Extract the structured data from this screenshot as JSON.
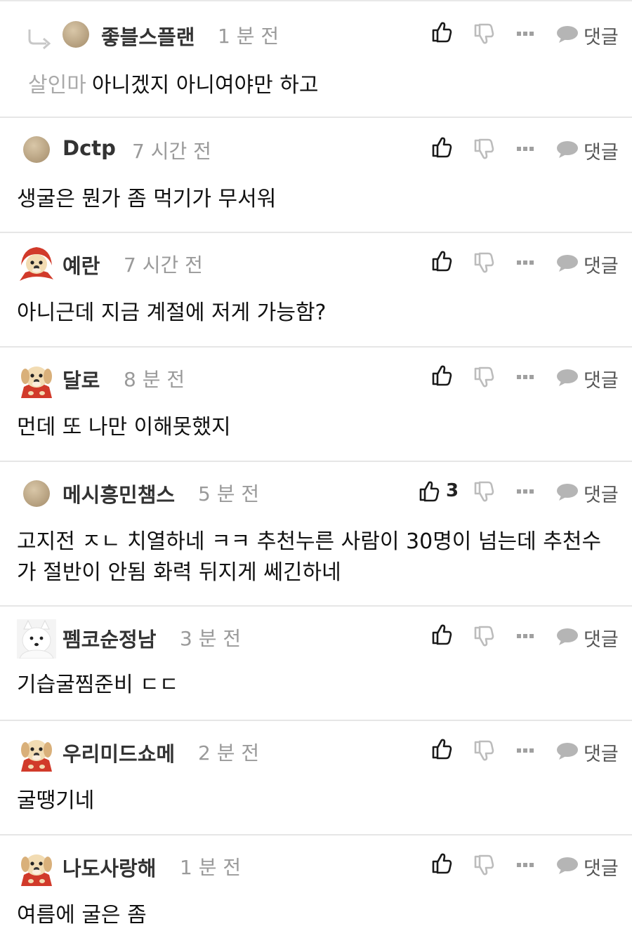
{
  "comments": [
    {
      "nickname": "좋블스플랜",
      "time": "1 분 전",
      "mention": "살인마",
      "text": "아니겠지 아니여야만 하고",
      "like_count": "",
      "reply_label": "댓글"
    },
    {
      "nickname": "Dctp",
      "time": "7 시간 전",
      "text": "생굴은 뭔가 좀 먹기가 무서워",
      "like_count": "",
      "reply_label": "댓글"
    },
    {
      "nickname": "예란",
      "time": "7 시간 전",
      "text": "아니근데 지금 계절에 저게 가능함?",
      "like_count": "",
      "reply_label": "댓글"
    },
    {
      "nickname": "달로",
      "time": "8 분 전",
      "text": "먼데 또 나만 이해못했지",
      "like_count": "",
      "reply_label": "댓글"
    },
    {
      "nickname": "메시흥민챔스",
      "time": "5 분 전",
      "text": "고지전 ㅈㄴ 치열하네 ㅋㅋ 추천누른 사람이 30명이 넘는데 추천수가 절반이 안됨 화력 뒤지게 쎄긴하네",
      "like_count": "3",
      "reply_label": "댓글"
    },
    {
      "nickname": "펨코순정남",
      "time": "3 분 전",
      "text": "기습굴찜준비 ㄷㄷ",
      "like_count": "",
      "reply_label": "댓글"
    },
    {
      "nickname": "우리미드쇼메",
      "time": "2 분 전",
      "text": "굴땡기네",
      "like_count": "",
      "reply_label": "댓글"
    },
    {
      "nickname": "나도사랑해",
      "time": "1 분 전",
      "text": "여름에 굴은 좀",
      "like_count": "",
      "reply_label": "댓글"
    }
  ],
  "icons": {
    "like": "thumbs-up-icon",
    "dislike": "thumbs-down-icon",
    "more": "more-dots-icon",
    "reply": "speech-bubble-icon",
    "reply_arrow": "reply-arrow-icon"
  },
  "colors": {
    "nickname": "#333333",
    "time": "#9a9a9a",
    "divider": "#e6e6e6",
    "mention": "#aaaaaa"
  }
}
